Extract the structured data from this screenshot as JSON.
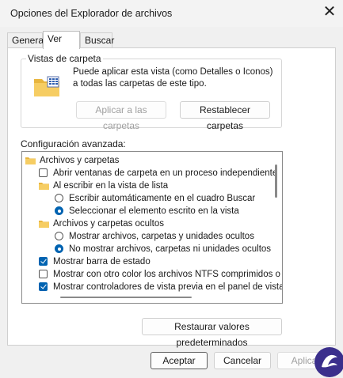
{
  "window": {
    "title": "Opciones del Explorador de archivos"
  },
  "tabs": [
    {
      "label": "General"
    },
    {
      "label": "Ver"
    },
    {
      "label": "Buscar"
    }
  ],
  "folder_views": {
    "title": "Vistas de carpeta",
    "description": "Puede aplicar esta vista (como Detalles o Iconos) a todas las carpetas de este tipo.",
    "apply_button": "Aplicar a las carpetas",
    "reset_button": "Restablecer carpetas"
  },
  "advanced": {
    "label": "Configuración avanzada:",
    "items": [
      {
        "kind": "folder",
        "text": "Archivos y carpetas"
      },
      {
        "kind": "checkbox",
        "checked": false,
        "text": "Abrir ventanas de carpeta  en un proceso independiente"
      },
      {
        "kind": "folder",
        "text": "Al escribir en la vista de lista"
      },
      {
        "kind": "radio",
        "checked": false,
        "text": "Escribir automáticamente en el cuadro Buscar"
      },
      {
        "kind": "radio",
        "checked": true,
        "text": "Seleccionar el elemento escrito en la vista"
      },
      {
        "kind": "folder",
        "text": "Archivos y carpetas ocultos"
      },
      {
        "kind": "radio",
        "checked": false,
        "text": "Mostrar archivos, carpetas y unidades ocultos"
      },
      {
        "kind": "radio",
        "checked": true,
        "text": "No mostrar archivos, carpetas ni unidades ocultos"
      },
      {
        "kind": "checkbox",
        "checked": true,
        "text": "Mostrar barra de estado"
      },
      {
        "kind": "checkbox",
        "checked": false,
        "text": "Mostrar con otro color los archivos NTFS comprimidos o c"
      },
      {
        "kind": "checkbox",
        "checked": true,
        "text": "Mostrar controladores de vista previa en el panel de vista"
      }
    ]
  },
  "restore_button": "Restaurar valores predeterminados",
  "footer": {
    "accept": "Aceptar",
    "cancel": "Cancelar",
    "apply": "Aplicar"
  },
  "icons": {
    "close": "close-icon",
    "folder": "folder-icon",
    "folder_view": "folder-view-icon"
  },
  "colors": {
    "accent": "#0063b1",
    "folder": "#f2c55c",
    "logo": "#3b2f8c"
  }
}
